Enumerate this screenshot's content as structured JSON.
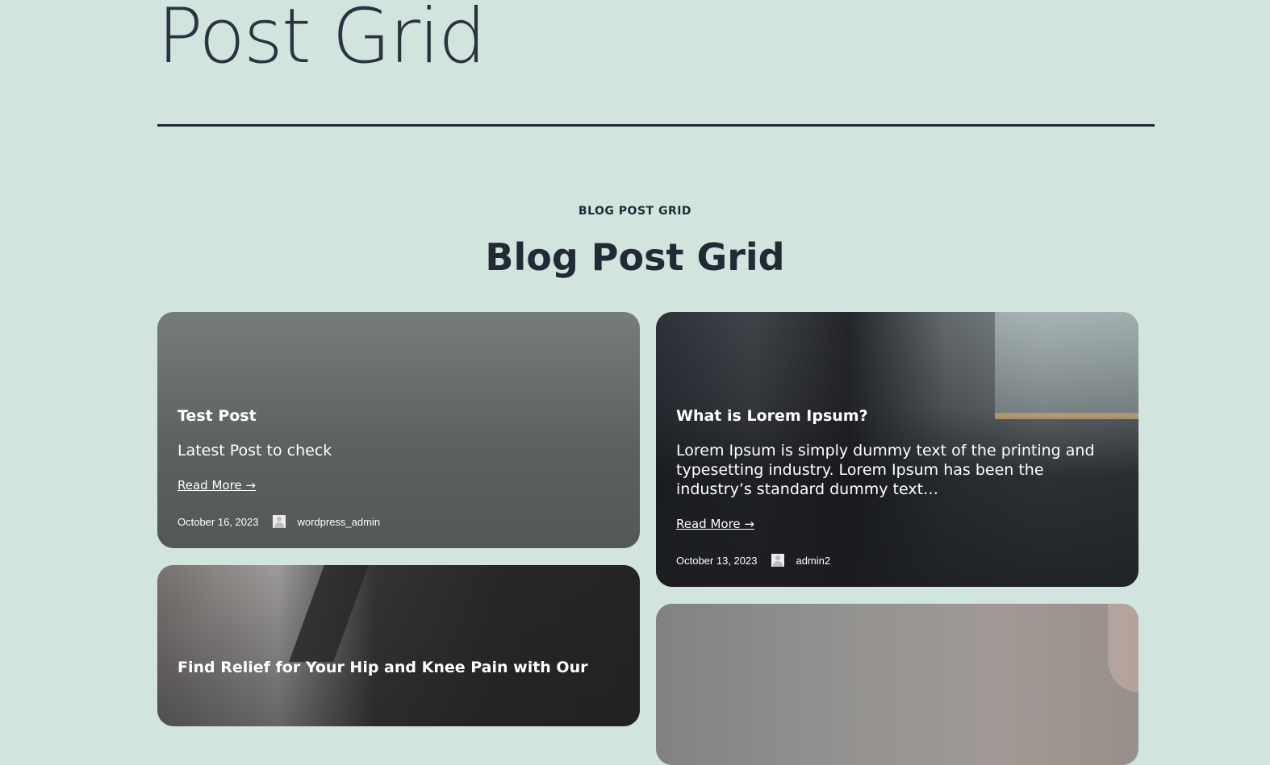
{
  "page": {
    "title": "Post Grid"
  },
  "section": {
    "eyebrow": "BLOG POST GRID",
    "heading": "Blog Post Grid"
  },
  "posts": [
    {
      "title": "Test Post",
      "excerpt": "Latest Post to check",
      "read_more": "Read More →",
      "date": "October 16, 2023",
      "author": "wordpress_admin"
    },
    {
      "title": "What is Lorem Ipsum?",
      "excerpt": "Lorem Ipsum is simply dummy text of the printing and typesetting industry. Lorem Ipsum has been the industry’s standard dummy text…",
      "read_more": "Read More →",
      "date": "October 13, 2023",
      "author": "admin2"
    },
    {
      "title": "Find Relief for Your Hip and Knee Pain with Our"
    },
    {
      "title": ""
    }
  ],
  "colors": {
    "background": "#d1e4de",
    "text_dark": "#222b35",
    "card_text": "#ffffff"
  }
}
